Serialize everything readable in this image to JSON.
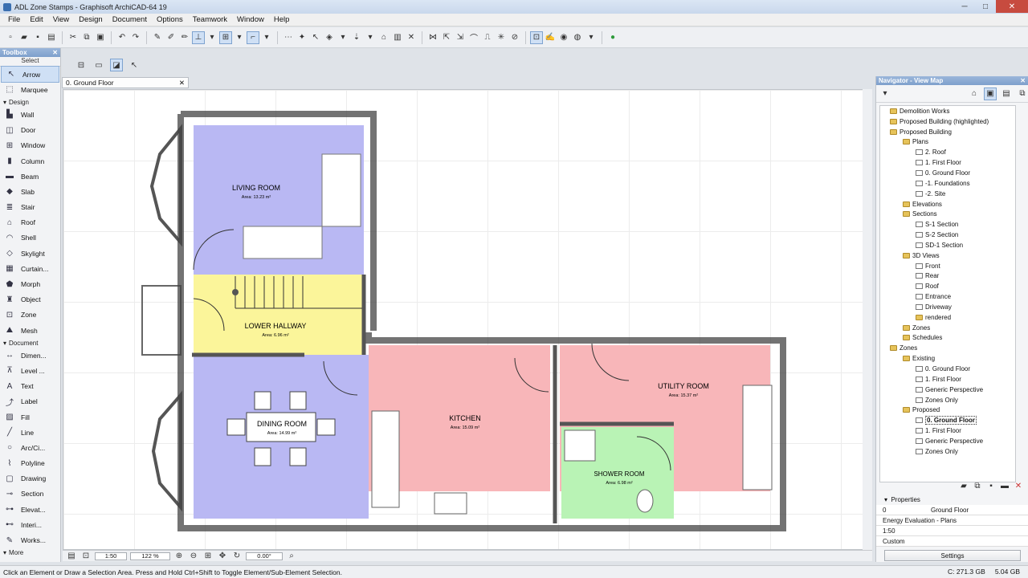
{
  "window": {
    "title": "ADL Zone Stamps - Graphisoft ArchiCAD-64 19"
  },
  "menu": [
    "File",
    "Edit",
    "View",
    "Design",
    "Document",
    "Options",
    "Teamwork",
    "Window",
    "Help"
  ],
  "toolbox": {
    "title": "Toolbox",
    "select_label": "Select",
    "arrow": "Arrow",
    "marquee": "Marquee",
    "design_group": "Design",
    "design_tools": [
      "Wall",
      "Door",
      "Window",
      "Column",
      "Beam",
      "Slab",
      "Stair",
      "Roof",
      "Shell",
      "Skylight",
      "Curtain...",
      "Morph",
      "Object",
      "Zone",
      "Mesh"
    ],
    "document_group": "Document",
    "document_tools": [
      "Dimen...",
      "Level ...",
      "Text",
      "Label",
      "Fill",
      "Line",
      "Arc/Ci...",
      "Polyline",
      "Drawing",
      "Section",
      "Elevat...",
      "Interi...",
      "Works..."
    ],
    "more": "More"
  },
  "tab": {
    "label": "0. Ground Floor"
  },
  "plan": {
    "rooms": [
      {
        "name": "LIVING ROOM",
        "area": "Area: 13.23 m²"
      },
      {
        "name": "LOWER HALLWAY",
        "area": "Area: 6.96 m²"
      },
      {
        "name": "DINING ROOM",
        "area": "Area: 14.99 m²"
      },
      {
        "name": "KITCHEN",
        "area": "Area: 15.09 m²"
      },
      {
        "name": "UTILITY ROOM",
        "area": "Area: 15.37 m²"
      },
      {
        "name": "SHOWER ROOM",
        "area": "Area: 6.98 m²"
      }
    ],
    "colors": {
      "living": "#b9b8f3",
      "hallway": "#fbf59a",
      "dining": "#b9b8f3",
      "kitchen": "#f8b6b9",
      "utility": "#f8b6b9",
      "shower": "#b9f3b5"
    }
  },
  "bottom_bar": {
    "scale": "1:50",
    "zoom": "122 %",
    "angle": "0.00°"
  },
  "navigator": {
    "title": "Navigator - View Map",
    "tree": [
      {
        "label": "Demolition Works",
        "level": 1,
        "type": "folder"
      },
      {
        "label": "Proposed Building (highlighted)",
        "level": 1,
        "type": "folder"
      },
      {
        "label": "Proposed Building",
        "level": 1,
        "type": "folder"
      },
      {
        "label": "Plans",
        "level": 2,
        "type": "folder"
      },
      {
        "label": "2. Roof",
        "level": 3,
        "type": "view"
      },
      {
        "label": "1. First Floor",
        "level": 3,
        "type": "view"
      },
      {
        "label": "0. Ground Floor",
        "level": 3,
        "type": "view"
      },
      {
        "label": "-1. Foundations",
        "level": 3,
        "type": "view"
      },
      {
        "label": "-2. Site",
        "level": 3,
        "type": "view"
      },
      {
        "label": "Elevations",
        "level": 2,
        "type": "folder"
      },
      {
        "label": "Sections",
        "level": 2,
        "type": "folder"
      },
      {
        "label": "S-1 Section",
        "level": 3,
        "type": "view"
      },
      {
        "label": "S-2 Section",
        "level": 3,
        "type": "view"
      },
      {
        "label": "SD-1 Section",
        "level": 3,
        "type": "view"
      },
      {
        "label": "3D Views",
        "level": 2,
        "type": "folder"
      },
      {
        "label": "Front",
        "level": 3,
        "type": "view"
      },
      {
        "label": "Rear",
        "level": 3,
        "type": "view"
      },
      {
        "label": "Roof",
        "level": 3,
        "type": "view"
      },
      {
        "label": "Entrance",
        "level": 3,
        "type": "view"
      },
      {
        "label": "Driveway",
        "level": 3,
        "type": "view"
      },
      {
        "label": "rendered",
        "level": 3,
        "type": "folder"
      },
      {
        "label": "Zones",
        "level": 2,
        "type": "folder"
      },
      {
        "label": "Schedules",
        "level": 2,
        "type": "folder"
      },
      {
        "label": "Zones",
        "level": 1,
        "type": "folder"
      },
      {
        "label": "Existing",
        "level": 2,
        "type": "folder"
      },
      {
        "label": "0. Ground Floor",
        "level": 3,
        "type": "view"
      },
      {
        "label": "1. First Floor",
        "level": 3,
        "type": "view"
      },
      {
        "label": "Generic Perspective",
        "level": 3,
        "type": "view"
      },
      {
        "label": "Zones Only",
        "level": 3,
        "type": "view"
      },
      {
        "label": "Proposed",
        "level": 2,
        "type": "folder"
      },
      {
        "label": "0. Ground Floor",
        "level": 3,
        "type": "view",
        "selected": true
      },
      {
        "label": "1. First Floor",
        "level": 3,
        "type": "view"
      },
      {
        "label": "Generic Perspective",
        "level": 3,
        "type": "view"
      },
      {
        "label": "Zones Only",
        "level": 3,
        "type": "view"
      }
    ],
    "properties_label": "Properties",
    "prop_id": "0",
    "prop_name": "Ground Floor",
    "prop_energy": "Energy Evaluation - Plans",
    "prop_scale": "1:50",
    "prop_custom": "Custom",
    "settings_button": "Settings"
  },
  "status": {
    "message": "Click an Element or Draw a Selection Area. Press and Hold Ctrl+Shift to Toggle Element/Sub-Element Selection.",
    "disk": "C: 271.3 GB",
    "memory": "5.04 GB"
  }
}
